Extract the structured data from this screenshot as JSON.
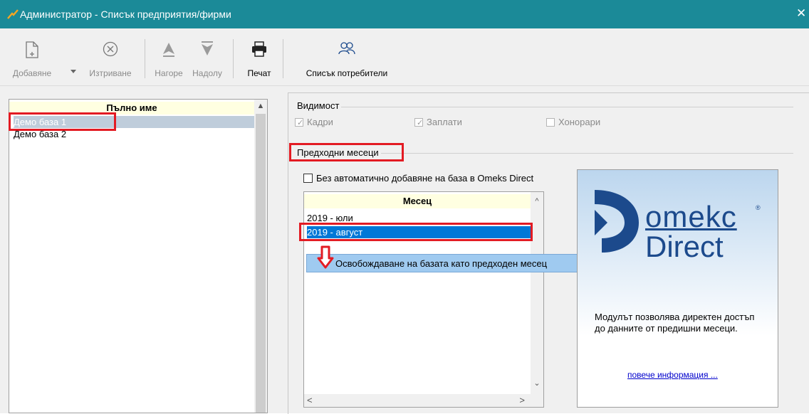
{
  "window": {
    "title": "Администратор - Списък предприятия/фирми",
    "close_glyph": "✕"
  },
  "toolbar": {
    "add_label": "Добавяне",
    "delete_label": "Изтриване",
    "up_label": "Нагоре",
    "down_label": "Надолу",
    "print_label": "Печат",
    "users_label": "Списък потребители"
  },
  "company_list": {
    "header": "Пълно име",
    "rows": [
      "Демо база 1",
      "Демо база 2"
    ],
    "selected_index": 0
  },
  "visibility": {
    "title": "Видимост",
    "kadri": {
      "label": "Кадри",
      "checked": true
    },
    "zaplati": {
      "label": "Заплати",
      "checked": true
    },
    "honorari": {
      "label": "Хонорари",
      "checked": false
    }
  },
  "prev_months": {
    "title": "Предходни месеци",
    "no_auto_add_label": "Без автоматично добавяне на база в Omeks Direct",
    "no_auto_add_checked": false,
    "column_header": "Месец",
    "rows": [
      "2019 - юли",
      "2019 - август"
    ],
    "selected_index": 1
  },
  "context_menu": {
    "item_label": "Освобождаване на базата като предходен месец"
  },
  "promo": {
    "logo_line1": "omekc",
    "logo_line2": "Direct",
    "registered": "®",
    "description": "Модулът позволява директен достъп до данните от предишни месеци.",
    "link": "повече информация ..."
  },
  "colors": {
    "titlebar": "#1b8a98",
    "highlight": "#e31b23",
    "selection": "#0078d7",
    "brand": "#1c4a8c"
  }
}
